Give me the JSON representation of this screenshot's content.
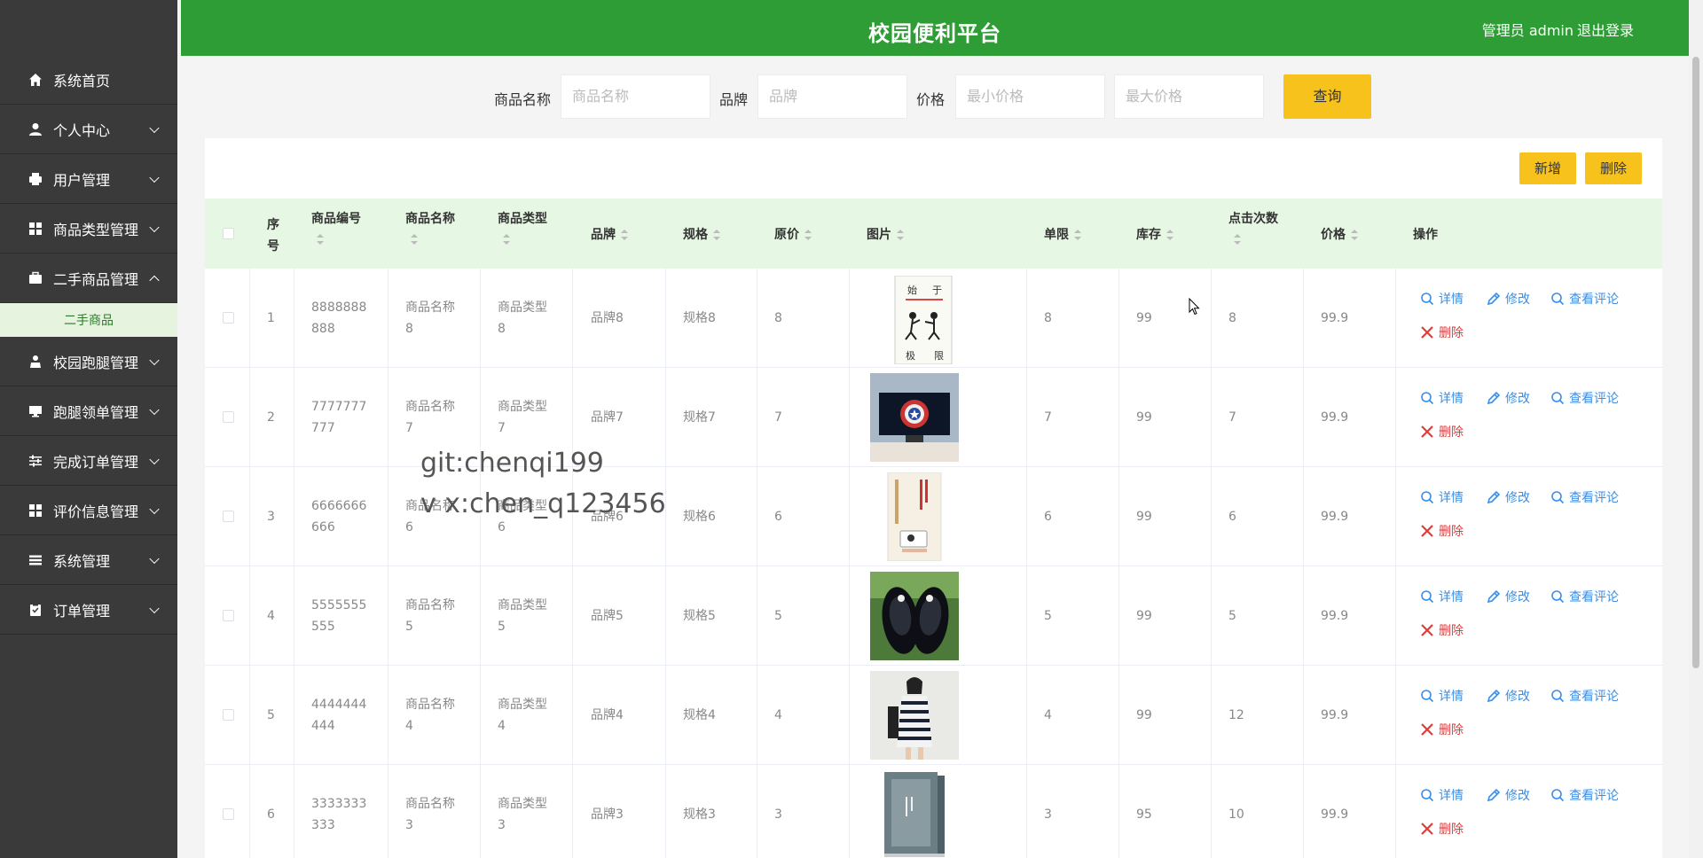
{
  "header": {
    "title": "校园便利平台",
    "user": "管理员 admin",
    "logout": "退出登录"
  },
  "sidebar": {
    "items": [
      {
        "label": "系统首页",
        "icon": "home-icon"
      },
      {
        "label": "个人中心",
        "icon": "user-icon"
      },
      {
        "label": "用户管理",
        "icon": "printer-icon"
      },
      {
        "label": "商品类型管理",
        "icon": "grid-icon"
      },
      {
        "label": "二手商品管理",
        "icon": "briefcase-icon"
      },
      {
        "label": "校园跑腿管理",
        "icon": "person-icon"
      },
      {
        "label": "跑腿领单管理",
        "icon": "monitor-icon"
      },
      {
        "label": "完成订单管理",
        "icon": "sliders-icon"
      },
      {
        "label": "评价信息管理",
        "icon": "grid-icon"
      },
      {
        "label": "系统管理",
        "icon": "list-icon"
      },
      {
        "label": "订单管理",
        "icon": "clipboard-icon"
      }
    ],
    "sub_active": "二手商品"
  },
  "search": {
    "name_label": "商品名称",
    "name_placeholder": "商品名称",
    "brand_label": "品牌",
    "brand_placeholder": "品牌",
    "price_label": "价格",
    "min_placeholder": "最小价格",
    "max_placeholder": "最大价格",
    "button": "查询"
  },
  "actions": {
    "add": "新增",
    "delete": "删除"
  },
  "table": {
    "headers": {
      "index": "序号",
      "code": "商品编号",
      "name": "商品名称",
      "type": "商品类型",
      "brand": "品牌",
      "spec": "规格",
      "orig": "原价",
      "image": "图片",
      "limit": "单限",
      "stock": "库存",
      "clicks": "点击次数",
      "price": "价格",
      "ops": "操作"
    },
    "ops": {
      "detail": "详情",
      "edit": "修改",
      "comments": "查看评论",
      "delete": "删除"
    },
    "rows": [
      {
        "index": "1",
        "code1": "8888888",
        "code2": "888",
        "name1": "商品名称",
        "name2": "8",
        "type1": "商品类型",
        "type2": "8",
        "brand": "品牌8",
        "spec": "规格8",
        "orig": "8",
        "limit": "8",
        "stock": "99",
        "clicks": "8",
        "price": "99.9",
        "img": "book-cover-1"
      },
      {
        "index": "2",
        "code1": "7777777",
        "code2": "777",
        "name1": "商品名称",
        "name2": "7",
        "type1": "商品类型",
        "type2": "7",
        "brand": "品牌7",
        "spec": "规格7",
        "orig": "7",
        "limit": "7",
        "stock": "99",
        "clicks": "7",
        "price": "99.9",
        "img": "monitor-photo"
      },
      {
        "index": "3",
        "code1": "6666666",
        "code2": "666",
        "name1": "商品名称",
        "name2": "6",
        "type1": "商品类型",
        "type2": "6",
        "brand": "品牌6",
        "spec": "规格6",
        "orig": "6",
        "limit": "6",
        "stock": "99",
        "clicks": "6",
        "price": "99.9",
        "img": "book-cover-2"
      },
      {
        "index": "4",
        "code1": "5555555",
        "code2": "555",
        "name1": "商品名称",
        "name2": "5",
        "type1": "商品类型",
        "type2": "5",
        "brand": "品牌5",
        "spec": "规格5",
        "orig": "5",
        "limit": "5",
        "stock": "99",
        "clicks": "5",
        "price": "99.9",
        "img": "shoes-photo"
      },
      {
        "index": "5",
        "code1": "4444444",
        "code2": "444",
        "name1": "商品名称",
        "name2": "4",
        "type1": "商品类型",
        "type2": "4",
        "brand": "品牌4",
        "spec": "规格4",
        "orig": "4",
        "limit": "4",
        "stock": "99",
        "clicks": "12",
        "price": "99.9",
        "img": "dress-photo"
      },
      {
        "index": "6",
        "code1": "3333333",
        "code2": "333",
        "name1": "商品名称",
        "name2": "3",
        "type1": "商品类型",
        "type2": "3",
        "brand": "品牌3",
        "spec": "规格3",
        "orig": "3",
        "limit": "3",
        "stock": "95",
        "clicks": "10",
        "price": "99.9",
        "img": "book-box-photo"
      }
    ]
  },
  "watermark": {
    "line1": "git:chenqi199",
    "line2": "v x:chen_q123456"
  },
  "book1": {
    "t1": "始",
    "t2": "于",
    "t3": "极",
    "t4": "限"
  },
  "colors": {
    "green": "#2f9d36",
    "yellow": "#f7c21b",
    "sidebar": "#3a3a3a",
    "link": "#3a8ee6",
    "danger": "#e23b3b"
  }
}
